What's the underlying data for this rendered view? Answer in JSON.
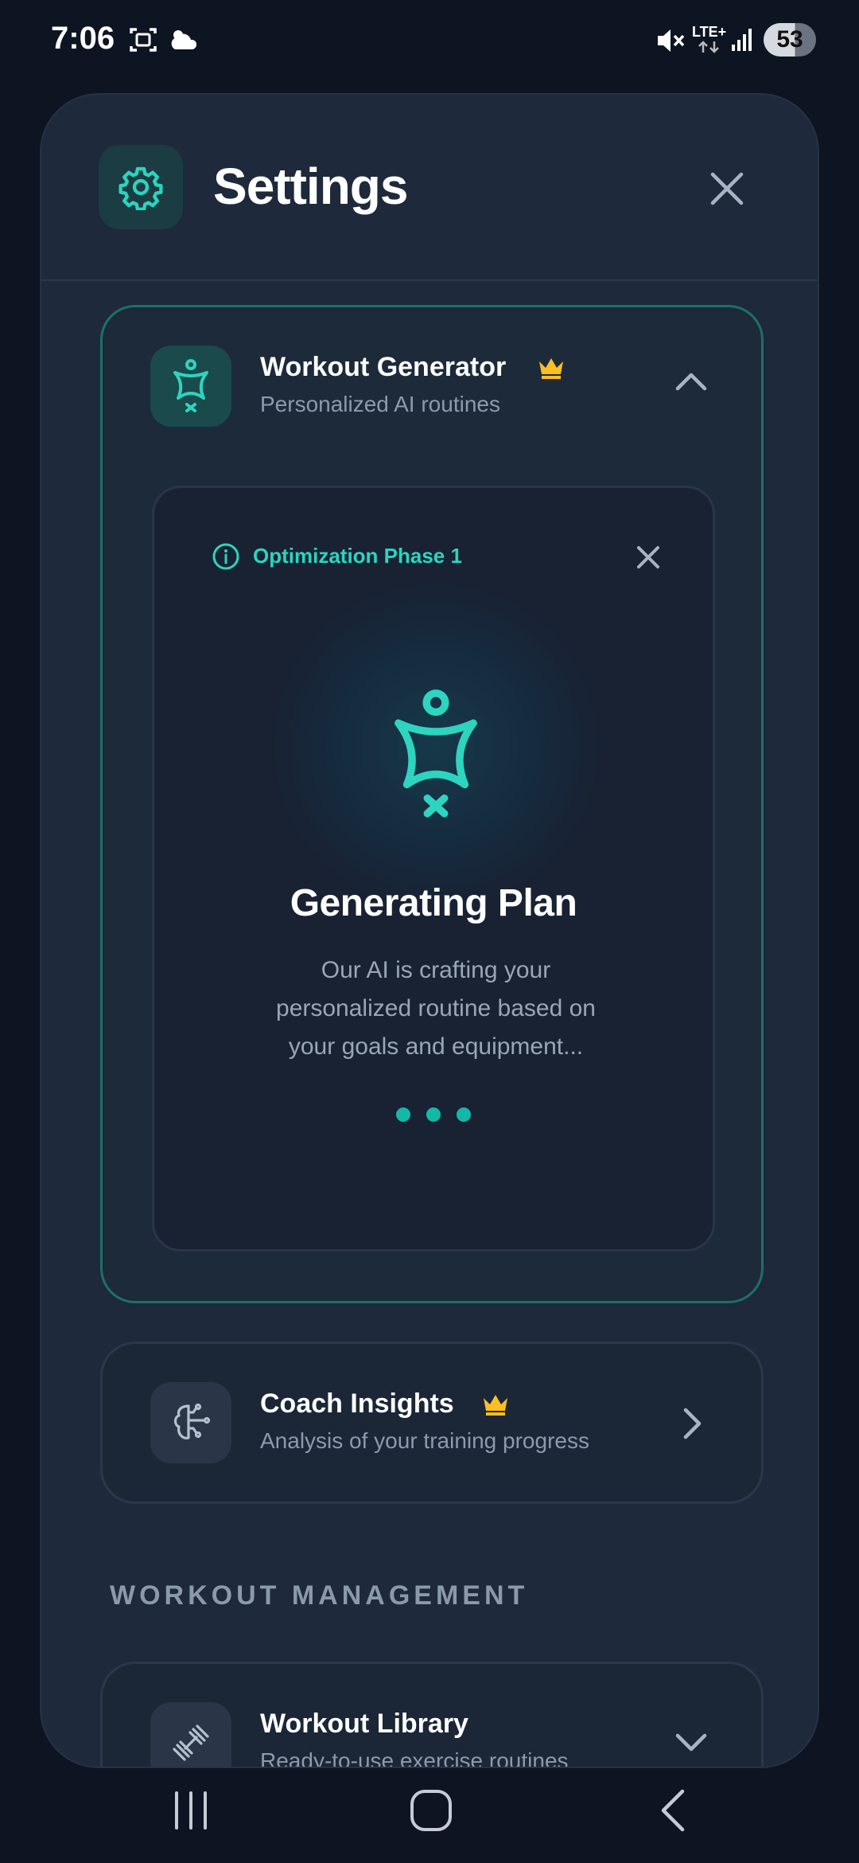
{
  "status_bar": {
    "time": "7:06",
    "network": "LTE+",
    "battery": "53"
  },
  "header": {
    "title": "Settings"
  },
  "workout_generator": {
    "title": "Workout Generator",
    "subtitle": "Personalized AI routines",
    "premium": true,
    "expanded": true,
    "panel": {
      "phase_label": "Optimization Phase 1",
      "title": "Generating Plan",
      "body": "Our AI is crafting your personalized routine based on your goals and equipment..."
    }
  },
  "coach_insights": {
    "title": "Coach Insights",
    "subtitle": "Analysis of your training progress",
    "premium": true
  },
  "section_workout_management": {
    "label": "WORKOUT MANAGEMENT"
  },
  "workout_library": {
    "title": "Workout Library",
    "subtitle": "Ready-to-use exercise routines"
  },
  "colors": {
    "accent": "#2dd4bf",
    "crown": "#fbbf24",
    "background": "#0d1422",
    "sheet": "#1e293b"
  },
  "icons": [
    "gear-icon",
    "close-icon",
    "fitness-figure-icon",
    "crown-icon",
    "chevron-up-icon",
    "info-icon",
    "brain-icon",
    "chevron-right-icon",
    "dumbbell-icon",
    "chevron-down-icon"
  ]
}
